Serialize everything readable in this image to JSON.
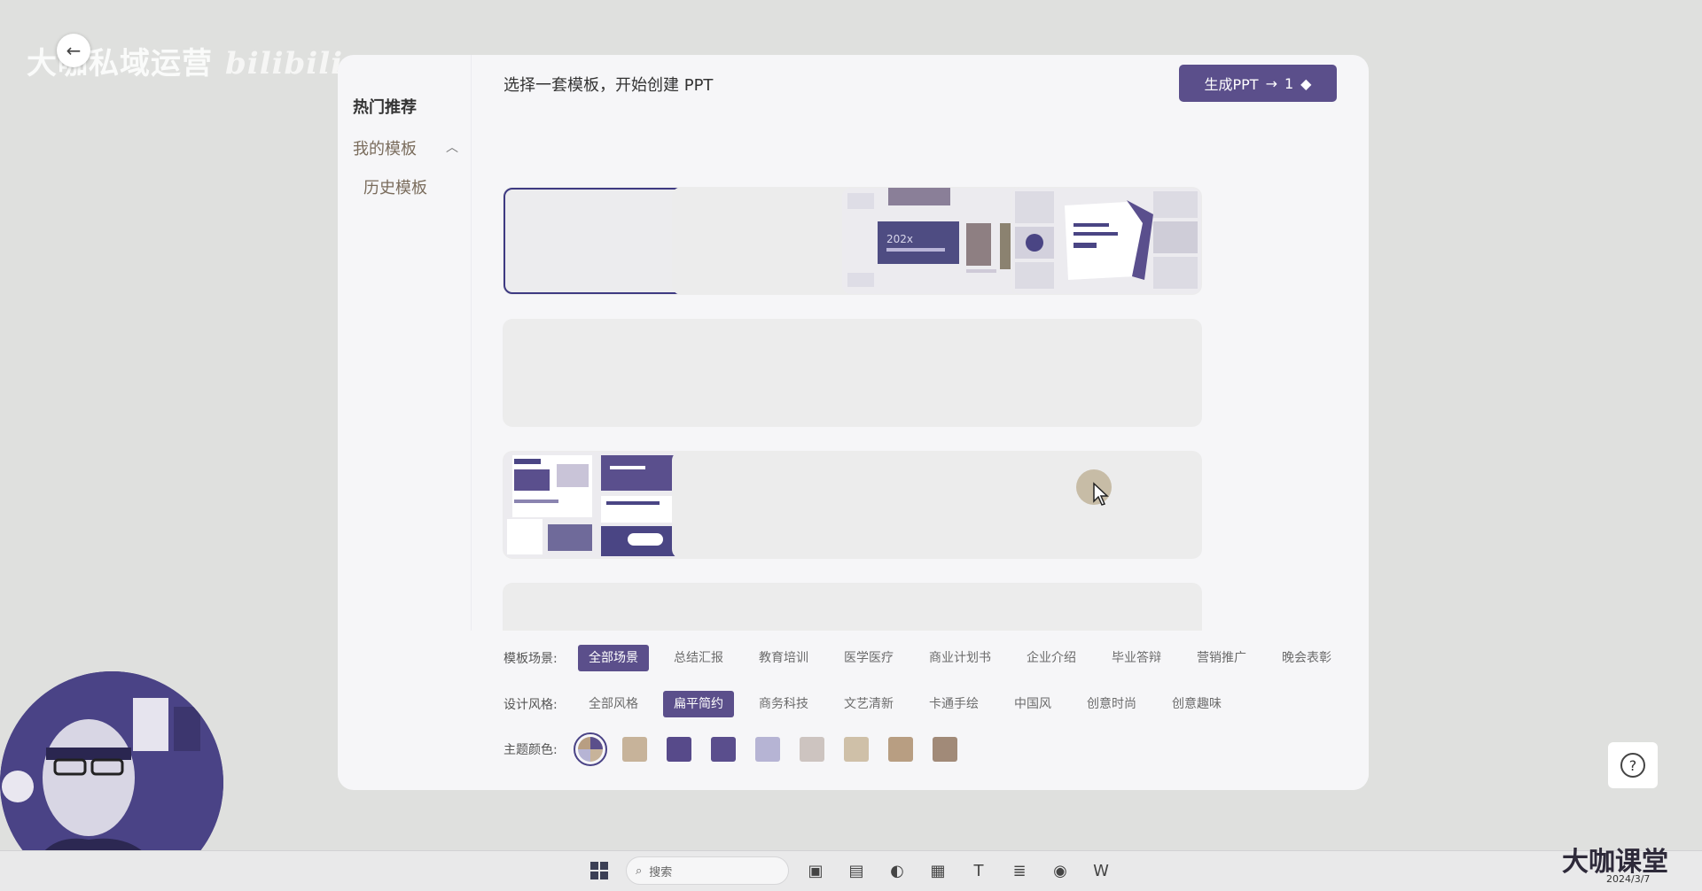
{
  "overlay": {
    "watermark_text": "大咖私域运营",
    "watermark_site": "bilibili",
    "stamp_text": "大咖课堂",
    "stamp_date": "2024/3/7"
  },
  "dialog": {
    "title": "选择一套模板，开始创建 PPT",
    "generate_label": "生成PPT",
    "generate_arrow": "→",
    "generate_count": "1"
  },
  "sidebar": {
    "items": [
      {
        "label": "热门推荐"
      },
      {
        "label": "我的模板"
      },
      {
        "label": "历史模板"
      }
    ]
  },
  "filters": {
    "scene_label": "模板场景:",
    "scene_options": [
      "全部场景",
      "总结汇报",
      "教育培训",
      "医学医疗",
      "商业计划书",
      "企业介绍",
      "毕业答辩",
      "营销推广",
      "晚会表彰"
    ],
    "scene_selected": "全部场景",
    "style_label": "设计风格:",
    "style_options": [
      "全部风格",
      "扁平简约",
      "商务科技",
      "文艺清新",
      "卡通手绘",
      "中国风",
      "创意时尚",
      "创意趣味"
    ],
    "style_selected": "扁平简约",
    "color_label": "主题颜色:",
    "colors": [
      "#b9a787",
      "#c7b39a",
      "#574a8a",
      "#5a4e8d",
      "#b6b4d4",
      "#cdc4c0",
      "#cfc0a8",
      "#b89e82",
      "#a18a78"
    ]
  },
  "taskbar": {
    "search_placeholder": "搜索",
    "icons": [
      "start-icon",
      "search-icon",
      "widgets-icon",
      "folder-icon",
      "edge-icon",
      "store-icon",
      "typora-icon",
      "notes-icon",
      "chrome-icon",
      "wps-icon"
    ]
  },
  "help": {
    "label": "?"
  },
  "accent": "#5b4f8b"
}
